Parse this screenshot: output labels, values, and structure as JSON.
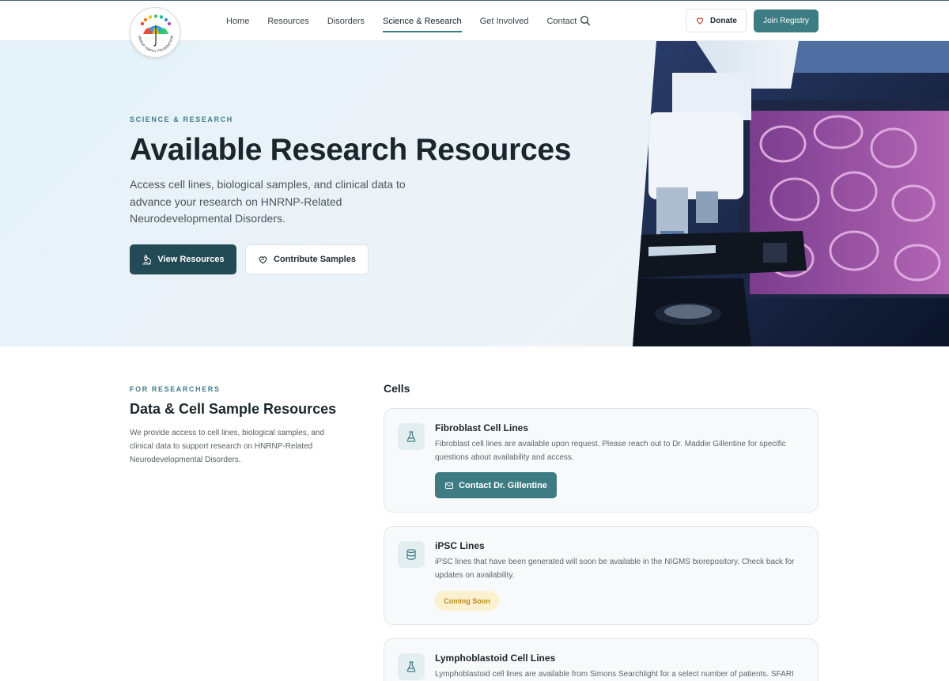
{
  "header": {
    "logo_text": "HNRNP FAMILY FOUNDATION",
    "nav": [
      {
        "label": "Home"
      },
      {
        "label": "Resources"
      },
      {
        "label": "Disorders"
      },
      {
        "label": "Science & Research",
        "active": true
      },
      {
        "label": "Get Involved"
      },
      {
        "label": "Contact"
      }
    ],
    "search_icon": "search-icon",
    "donate_label": "Donate",
    "join_label": "Join Registry"
  },
  "hero": {
    "eyebrow": "SCIENCE & RESEARCH",
    "title": "Available Research Resources",
    "description": "Access cell lines, biological samples, and clinical data to advance your research on HNRNP-Related Neurodevelopmental Disorders.",
    "primary_button": "View Resources",
    "secondary_button": "Contribute Samples"
  },
  "researchers": {
    "eyebrow": "FOR RESEARCHERS",
    "title": "Data & Cell Sample Resources",
    "description": "We provide access to cell lines, biological samples, and clinical data to support research on HNRNP-Related Neurodevelopmental Disorders."
  },
  "cells": {
    "heading": "Cells",
    "cards": [
      {
        "title": "Fibroblast Cell Lines",
        "description": "Fibroblast cell lines are available upon request. Please reach out to Dr. Maddie Gillentine for specific questions about availability and access.",
        "button": "Contact Dr. Gillentine",
        "icon": "flask-icon"
      },
      {
        "title": "iPSC Lines",
        "description": "iPSC lines that have been generated will soon be available in the NIGMS biorepository. Check back for updates on availability.",
        "badge": "Coming Soon",
        "icon": "database-icon"
      },
      {
        "title": "Lymphoblastoid Cell Lines",
        "description": "Lymphoblastoid cell lines are available from Simons Searchlight for a select number of patients. SFARI",
        "icon": "flask-icon"
      }
    ]
  },
  "colors": {
    "primary": "#3e7c84",
    "primary_dark": "#234b55",
    "badge_bg": "#fbf1cf",
    "badge_text": "#b88a1c"
  }
}
